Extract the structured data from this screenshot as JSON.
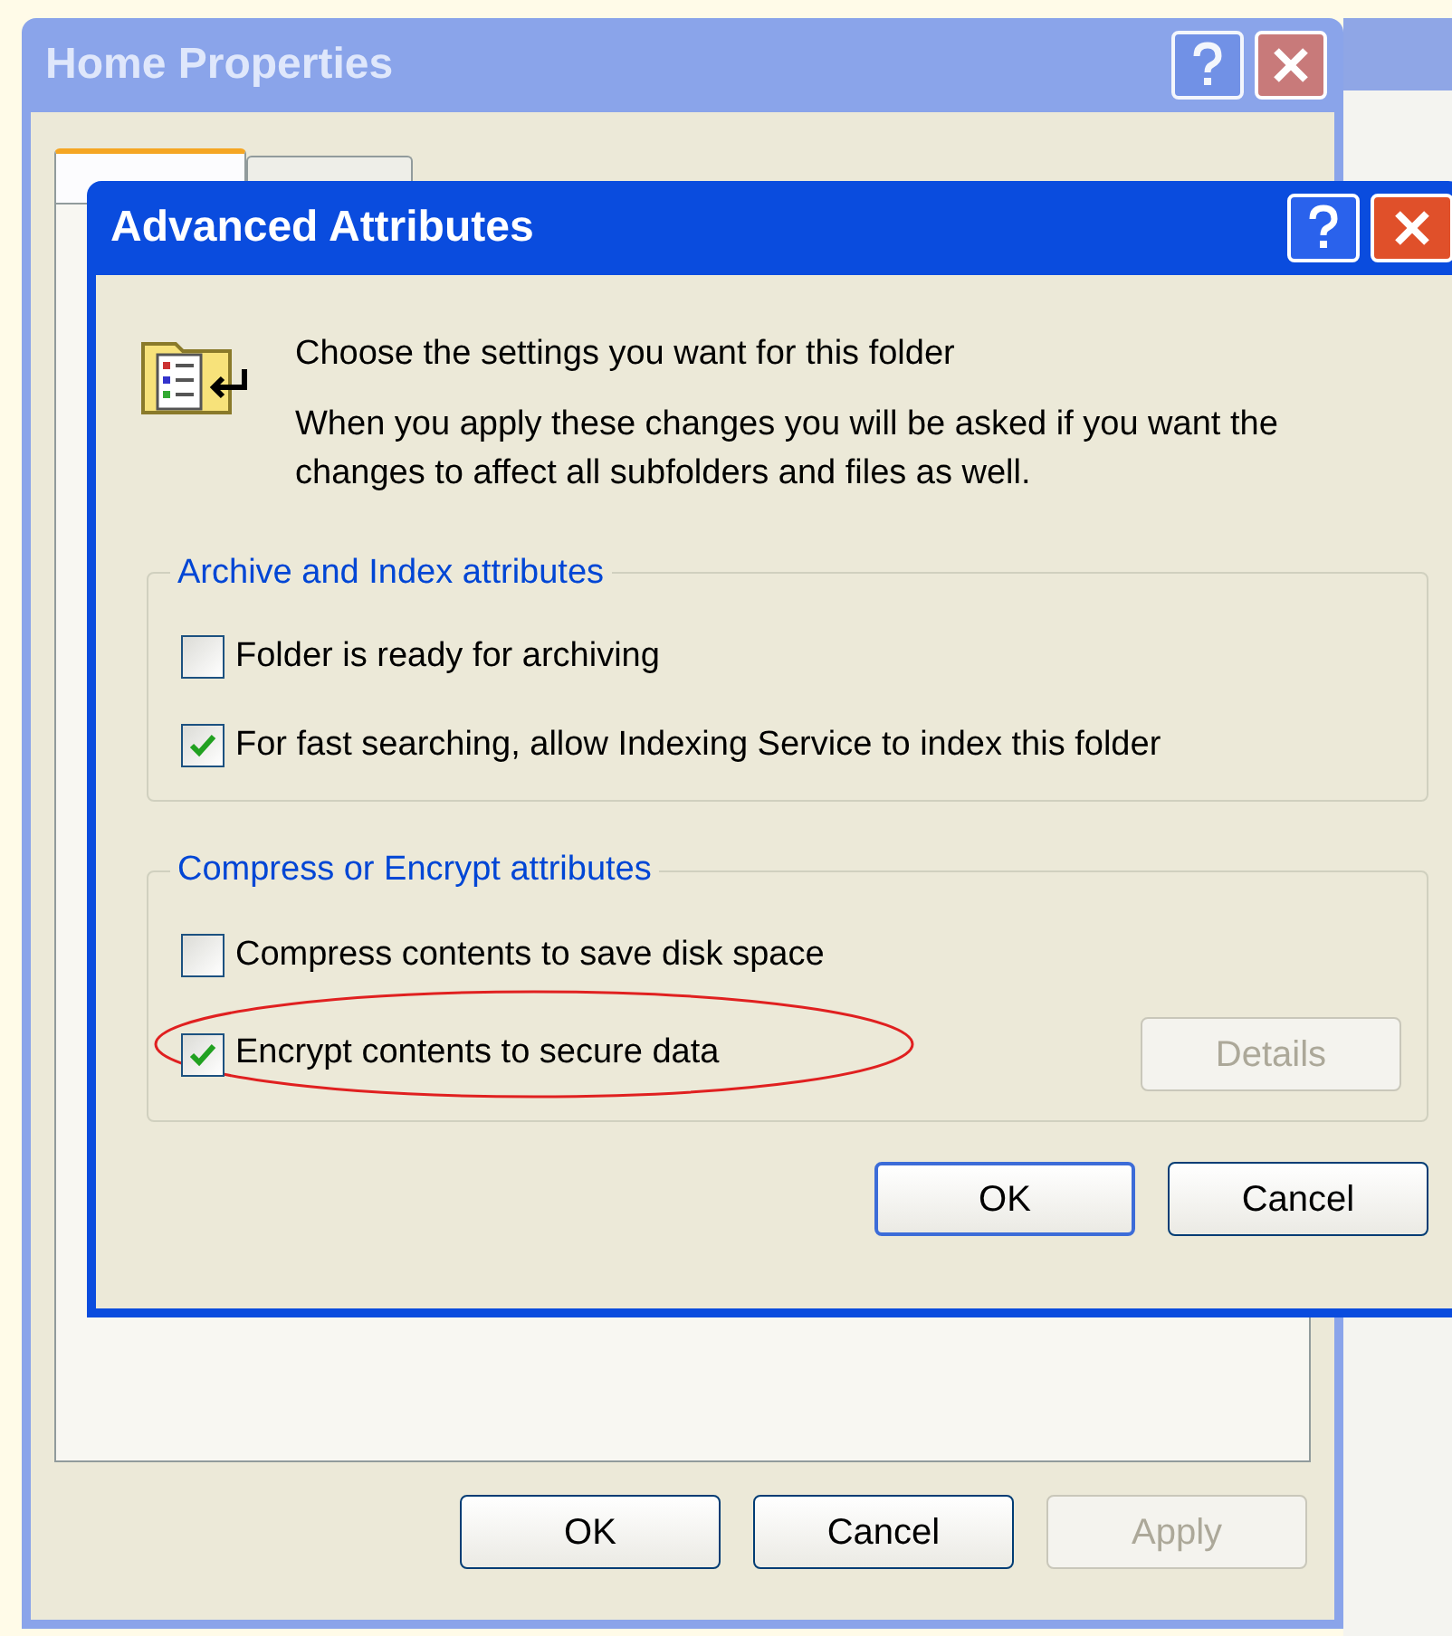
{
  "back_window": {
    "title": "Home Properties",
    "tabs": [
      {
        "selected": true
      },
      {
        "selected": false
      }
    ],
    "buttons": [
      {
        "label": "OK",
        "disabled": false
      },
      {
        "label": "Cancel",
        "disabled": false
      },
      {
        "label": "Apply",
        "disabled": true
      }
    ]
  },
  "dialog": {
    "title": "Advanced Attributes",
    "heading": "Choose the settings you want for this folder",
    "description": "When you apply these changes you will be asked if you want the changes to affect all subfolders and files as well.",
    "groups": [
      {
        "legend": "Archive and Index attributes",
        "options": [
          {
            "label": "Folder is ready for archiving",
            "checked": false,
            "highlighted": false
          },
          {
            "label": "For fast searching, allow Indexing Service to index this folder",
            "checked": true,
            "highlighted": false
          }
        ]
      },
      {
        "legend": "Compress or Encrypt attributes",
        "options": [
          {
            "label": "Compress contents to save disk space",
            "checked": false,
            "highlighted": false
          },
          {
            "label": "Encrypt contents to secure data",
            "checked": true,
            "highlighted": true
          }
        ],
        "details_button": {
          "label": "Details",
          "disabled": true
        }
      }
    ],
    "buttons": [
      {
        "label": "OK",
        "default": true
      },
      {
        "label": "Cancel",
        "default": false
      }
    ]
  }
}
